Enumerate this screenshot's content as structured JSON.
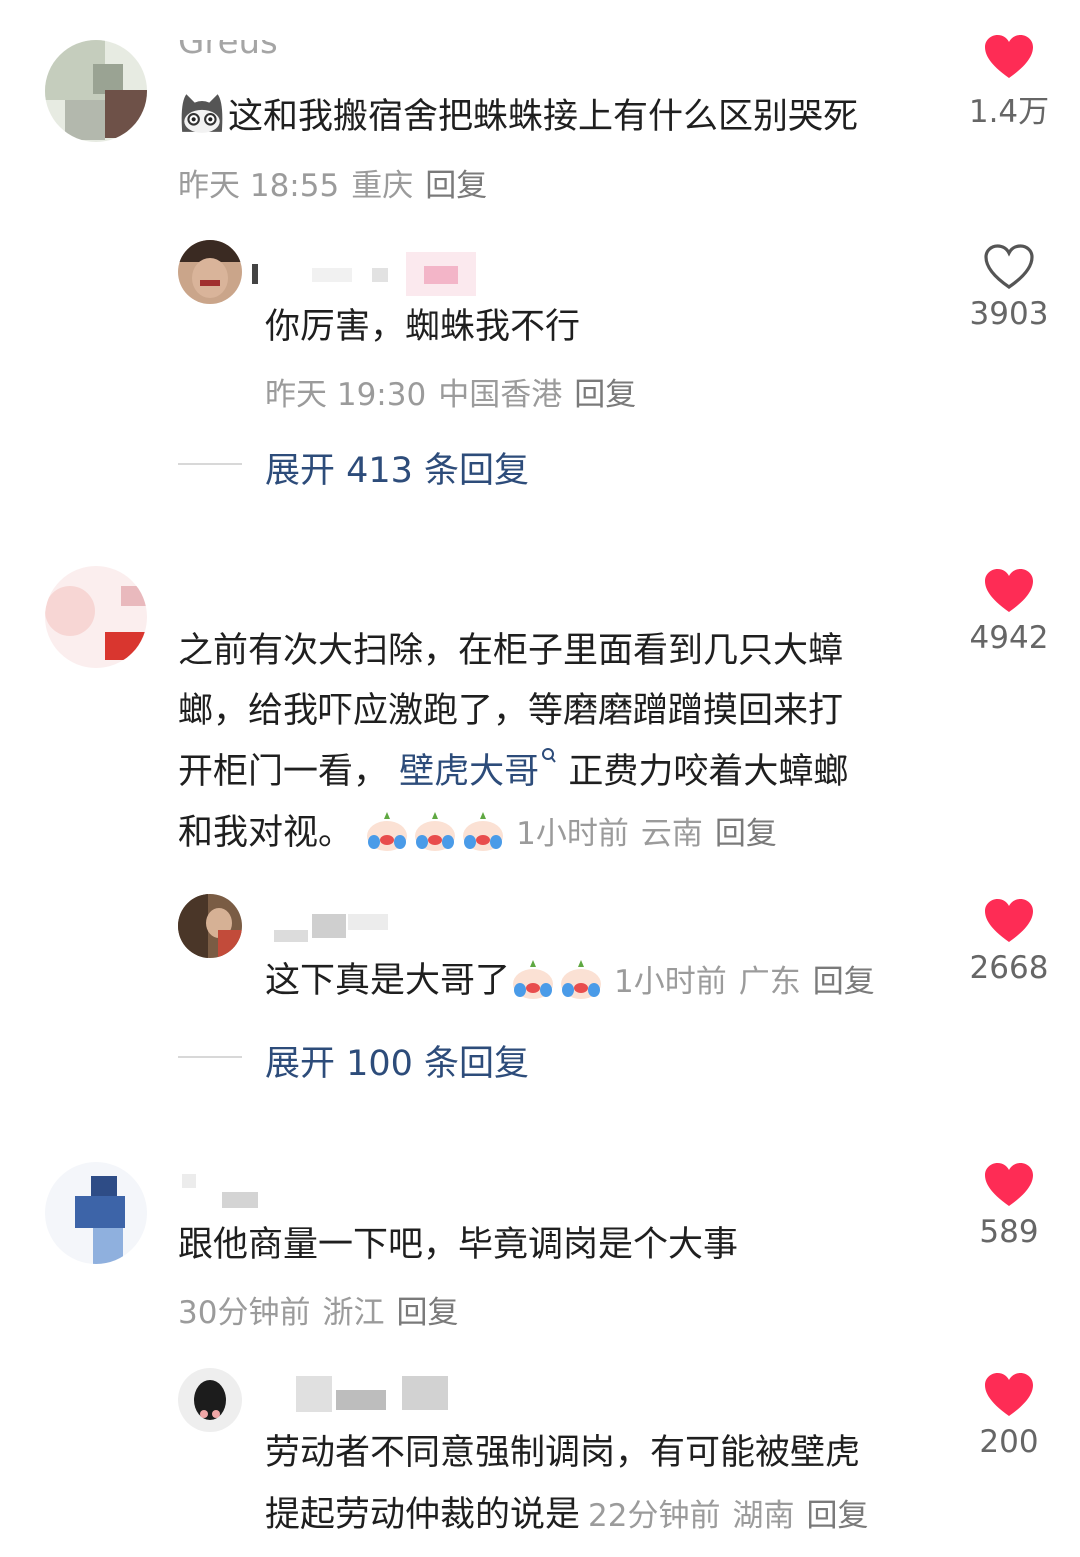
{
  "comments": [
    {
      "text": "这和我搬宿舍把蛛蛛接上有什么区别哭死",
      "nickname_visible": "Greus",
      "time": "昨天 18:55",
      "location": "重庆",
      "reply_label": "回复",
      "likes": "1.4万",
      "liked": true,
      "replies": [
        {
          "text": "你厉害，蜘蛛我不行",
          "time": "昨天 19:30",
          "location": "中国香港",
          "reply_label": "回复",
          "likes": "3903",
          "liked": false
        }
      ],
      "expand": "展开 413 条回复"
    },
    {
      "text_lines": [
        "之前有次大扫除，在柜子里面看到几只大蟑",
        "螂，给我吓应激跑了，等磨磨蹭蹭摸回来打",
        "开柜门一看，",
        "正费力咬着大蟑螂",
        "和我对视。"
      ],
      "link_text": "壁虎大哥",
      "time": "1小时前",
      "location": "云南",
      "reply_label": "回复",
      "likes": "4942",
      "liked": true,
      "replies": [
        {
          "text": "这下真是大哥了",
          "time": "1小时前",
          "location": "广东",
          "reply_label": "回复",
          "likes": "2668",
          "liked": true
        }
      ],
      "expand": "展开 100 条回复"
    },
    {
      "text": "跟他商量一下吧，毕竟调岗是个大事",
      "time": "30分钟前",
      "location": "浙江",
      "reply_label": "回复",
      "likes": "589",
      "liked": true,
      "replies": [
        {
          "text_lines": [
            "劳动者不同意强制调岗，有可能被壁虎",
            "提起劳动仲裁的说是"
          ],
          "time": "22分钟前",
          "location": "湖南",
          "reply_label": "回复",
          "likes": "200",
          "liked": true
        }
      ]
    }
  ],
  "colors": {
    "heart_red": "#fe2c55",
    "link_blue": "#2d4c7a",
    "meta_gray": "#9b9b9b"
  },
  "icons": {
    "like": "heart-icon",
    "search_link": "search-icon",
    "emoji": "crying-emoji-icon",
    "cat": "cat-emoji-icon"
  }
}
